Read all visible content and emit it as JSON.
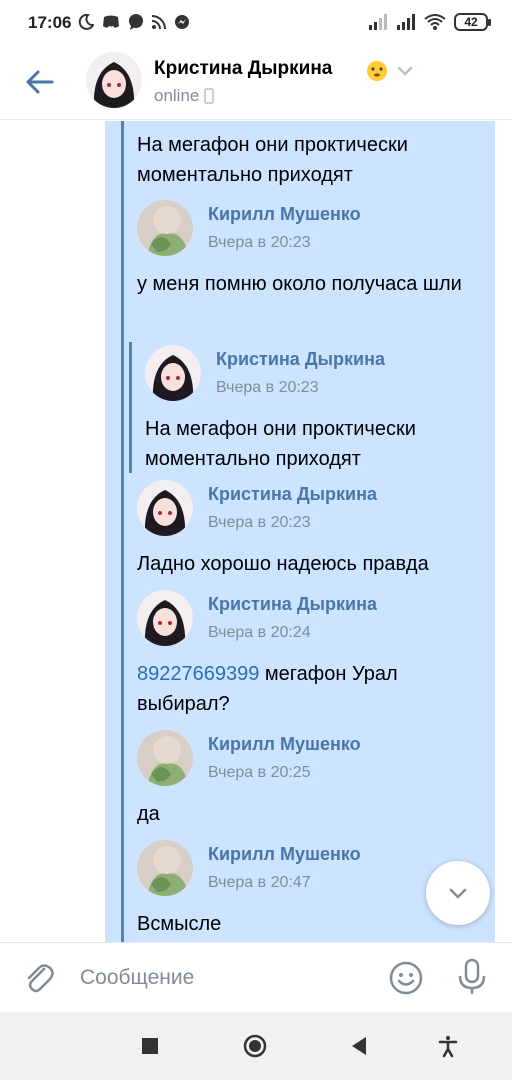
{
  "statusbar": {
    "time": "17:06",
    "battery": "42",
    "left_icons": [
      "moon-icon",
      "discord-icon",
      "chat-icon",
      "rss-icon",
      "messenger-icon"
    ],
    "right_icons": [
      "signal-icon",
      "signal-icon",
      "wifi-icon",
      "battery-icon"
    ]
  },
  "header": {
    "name": "Кристина Дыркина",
    "status": "online",
    "emoji": "face-emoji",
    "back_icon": "arrow-left-icon",
    "chevron_icon": "chevron-down-icon"
  },
  "messages": {
    "first_text": "На мегафон они проктически моментально приходят",
    "q1": {
      "name": "Кирилл Мушенко",
      "time": "Вчера в 20:23",
      "text": "у меня помню около получаса шли"
    },
    "q1_quote": {
      "name": "Кристина Дыркина",
      "time": "Вчера в 20:23",
      "text": "На мегафон они проктически моментально приходят"
    },
    "q2": {
      "name": "Кристина Дыркина",
      "time": "Вчера в 20:23",
      "text": "Ладно хорошо надеюсь правда"
    },
    "q3": {
      "name": "Кристина Дыркина",
      "time": "Вчера в 20:24",
      "link": "89227669399",
      "text": " мегафон Урал выбирал?"
    },
    "q4": {
      "name": "Кирилл Мушенко",
      "time": "Вчера в 20:25",
      "text": "да"
    },
    "q5": {
      "name": "Кирилл Мушенко",
      "time": "Вчера в 20:47",
      "text": "Всмысле"
    }
  },
  "composer": {
    "placeholder": "Сообщение"
  },
  "colors": {
    "bubble": "#cce4ff",
    "accent": "#4a76a8",
    "link": "#2a6fb0",
    "muted": "#818c99"
  }
}
